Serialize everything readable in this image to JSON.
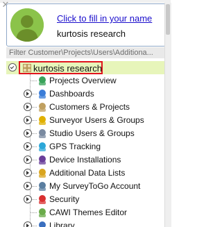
{
  "close_glyph": "✕",
  "profile": {
    "fill_link": "Click to fill in your name",
    "account_name": "kurtosis research"
  },
  "filter": {
    "text": "Filter Customer\\Projects\\Users\\Additiona..."
  },
  "tree": {
    "root": {
      "label": "kurtosis research",
      "icon": "org-grid-icon",
      "expanded": true
    },
    "items": [
      {
        "label": "Projects Overview",
        "icon": "projects-overview-icon",
        "color": "#3aa35a",
        "expandable": false
      },
      {
        "label": "Dashboards",
        "icon": "dashboards-icon",
        "color": "#3b7dd8",
        "expandable": true
      },
      {
        "label": "Customers & Projects",
        "icon": "customers-projects-icon",
        "color": "#c0a060",
        "expandable": true
      },
      {
        "label": "Surveyor Users & Groups",
        "icon": "surveyor-users-icon",
        "color": "#e0b000",
        "expandable": true
      },
      {
        "label": "Studio Users & Groups",
        "icon": "studio-users-icon",
        "color": "#7a8aa0",
        "expandable": true
      },
      {
        "label": "GPS Tracking",
        "icon": "gps-tracking-icon",
        "color": "#2ca7d8",
        "expandable": true
      },
      {
        "label": "Device Installations",
        "icon": "device-installations-icon",
        "color": "#6a3f9a",
        "expandable": true
      },
      {
        "label": "Additional Data Lists",
        "icon": "data-lists-icon",
        "color": "#d9a520",
        "expandable": true
      },
      {
        "label": "My SurveyToGo Account",
        "icon": "account-icon",
        "color": "#5a7ea0",
        "expandable": true
      },
      {
        "label": "Security",
        "icon": "security-icon",
        "color": "#d93030",
        "expandable": true
      },
      {
        "label": "CAWI Themes Editor",
        "icon": "themes-editor-icon",
        "color": "#6aab4a",
        "expandable": false
      },
      {
        "label": "Library",
        "icon": "library-icon",
        "color": "#3a6fbf",
        "expandable": true
      }
    ]
  }
}
